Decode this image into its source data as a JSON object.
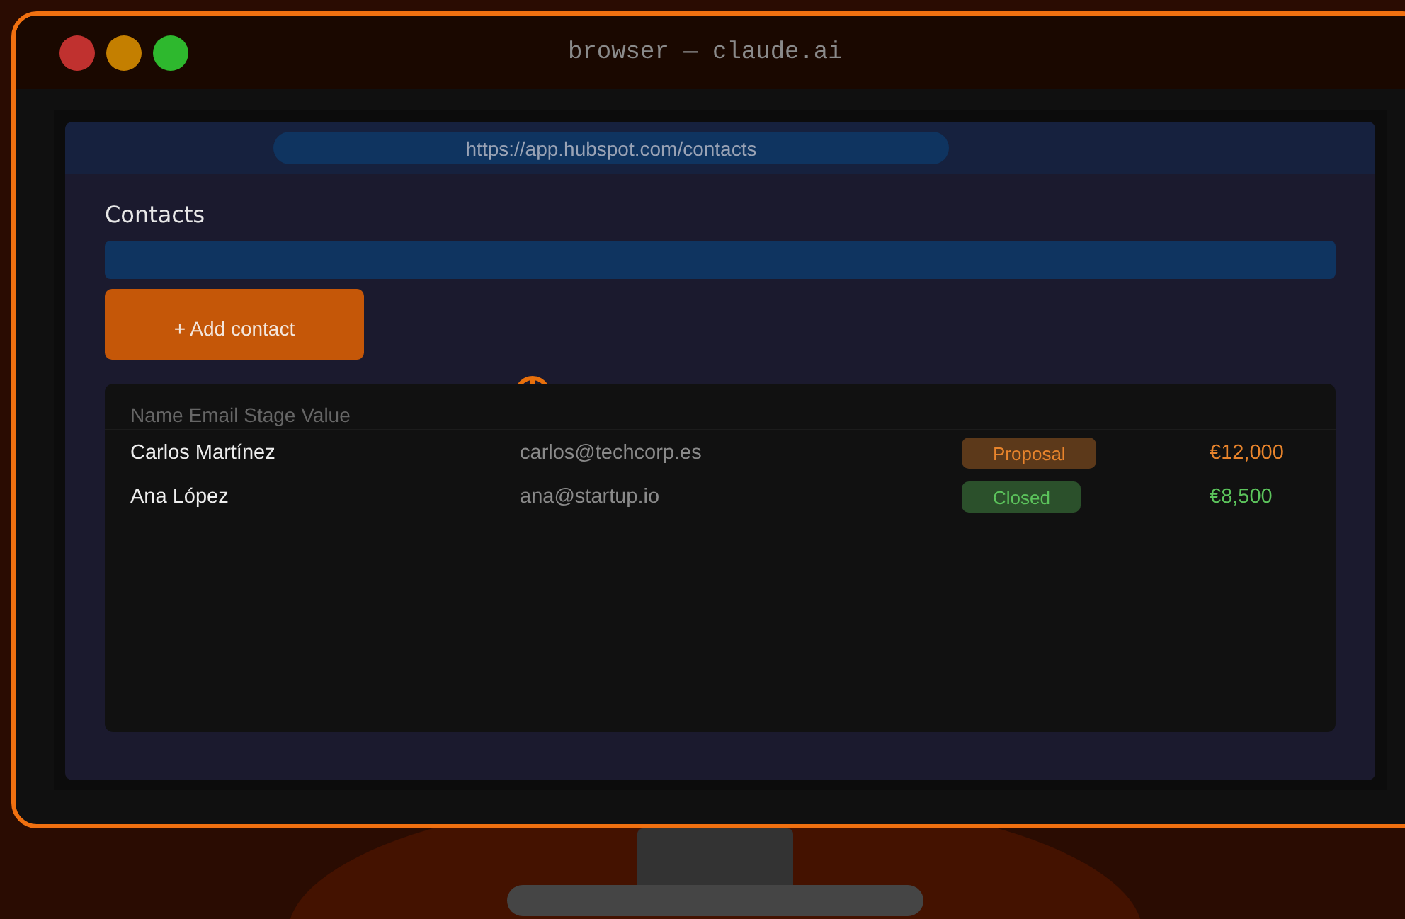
{
  "window": {
    "title": "browser — claude.ai"
  },
  "window_controls": [
    {
      "color": "#c0312f"
    },
    {
      "color": "#c47f00"
    },
    {
      "color": "#2eb82e"
    }
  ],
  "browser": {
    "url": "https://app.hubspot.com/contacts"
  },
  "page": {
    "title": "Contacts",
    "add_button": "+ Add contact",
    "table": {
      "header": "Name Email Stage Value",
      "rows": [
        {
          "name": "Carlos Martínez",
          "email": "carlos@techcorp.es",
          "stage": "Proposal",
          "value": "€12,000",
          "color": "#e8842c"
        },
        {
          "name": "Ana López",
          "email": "ana@startup.io",
          "stage": "Closed",
          "value": "€8,500",
          "color": "#5cc45c"
        }
      ]
    }
  }
}
